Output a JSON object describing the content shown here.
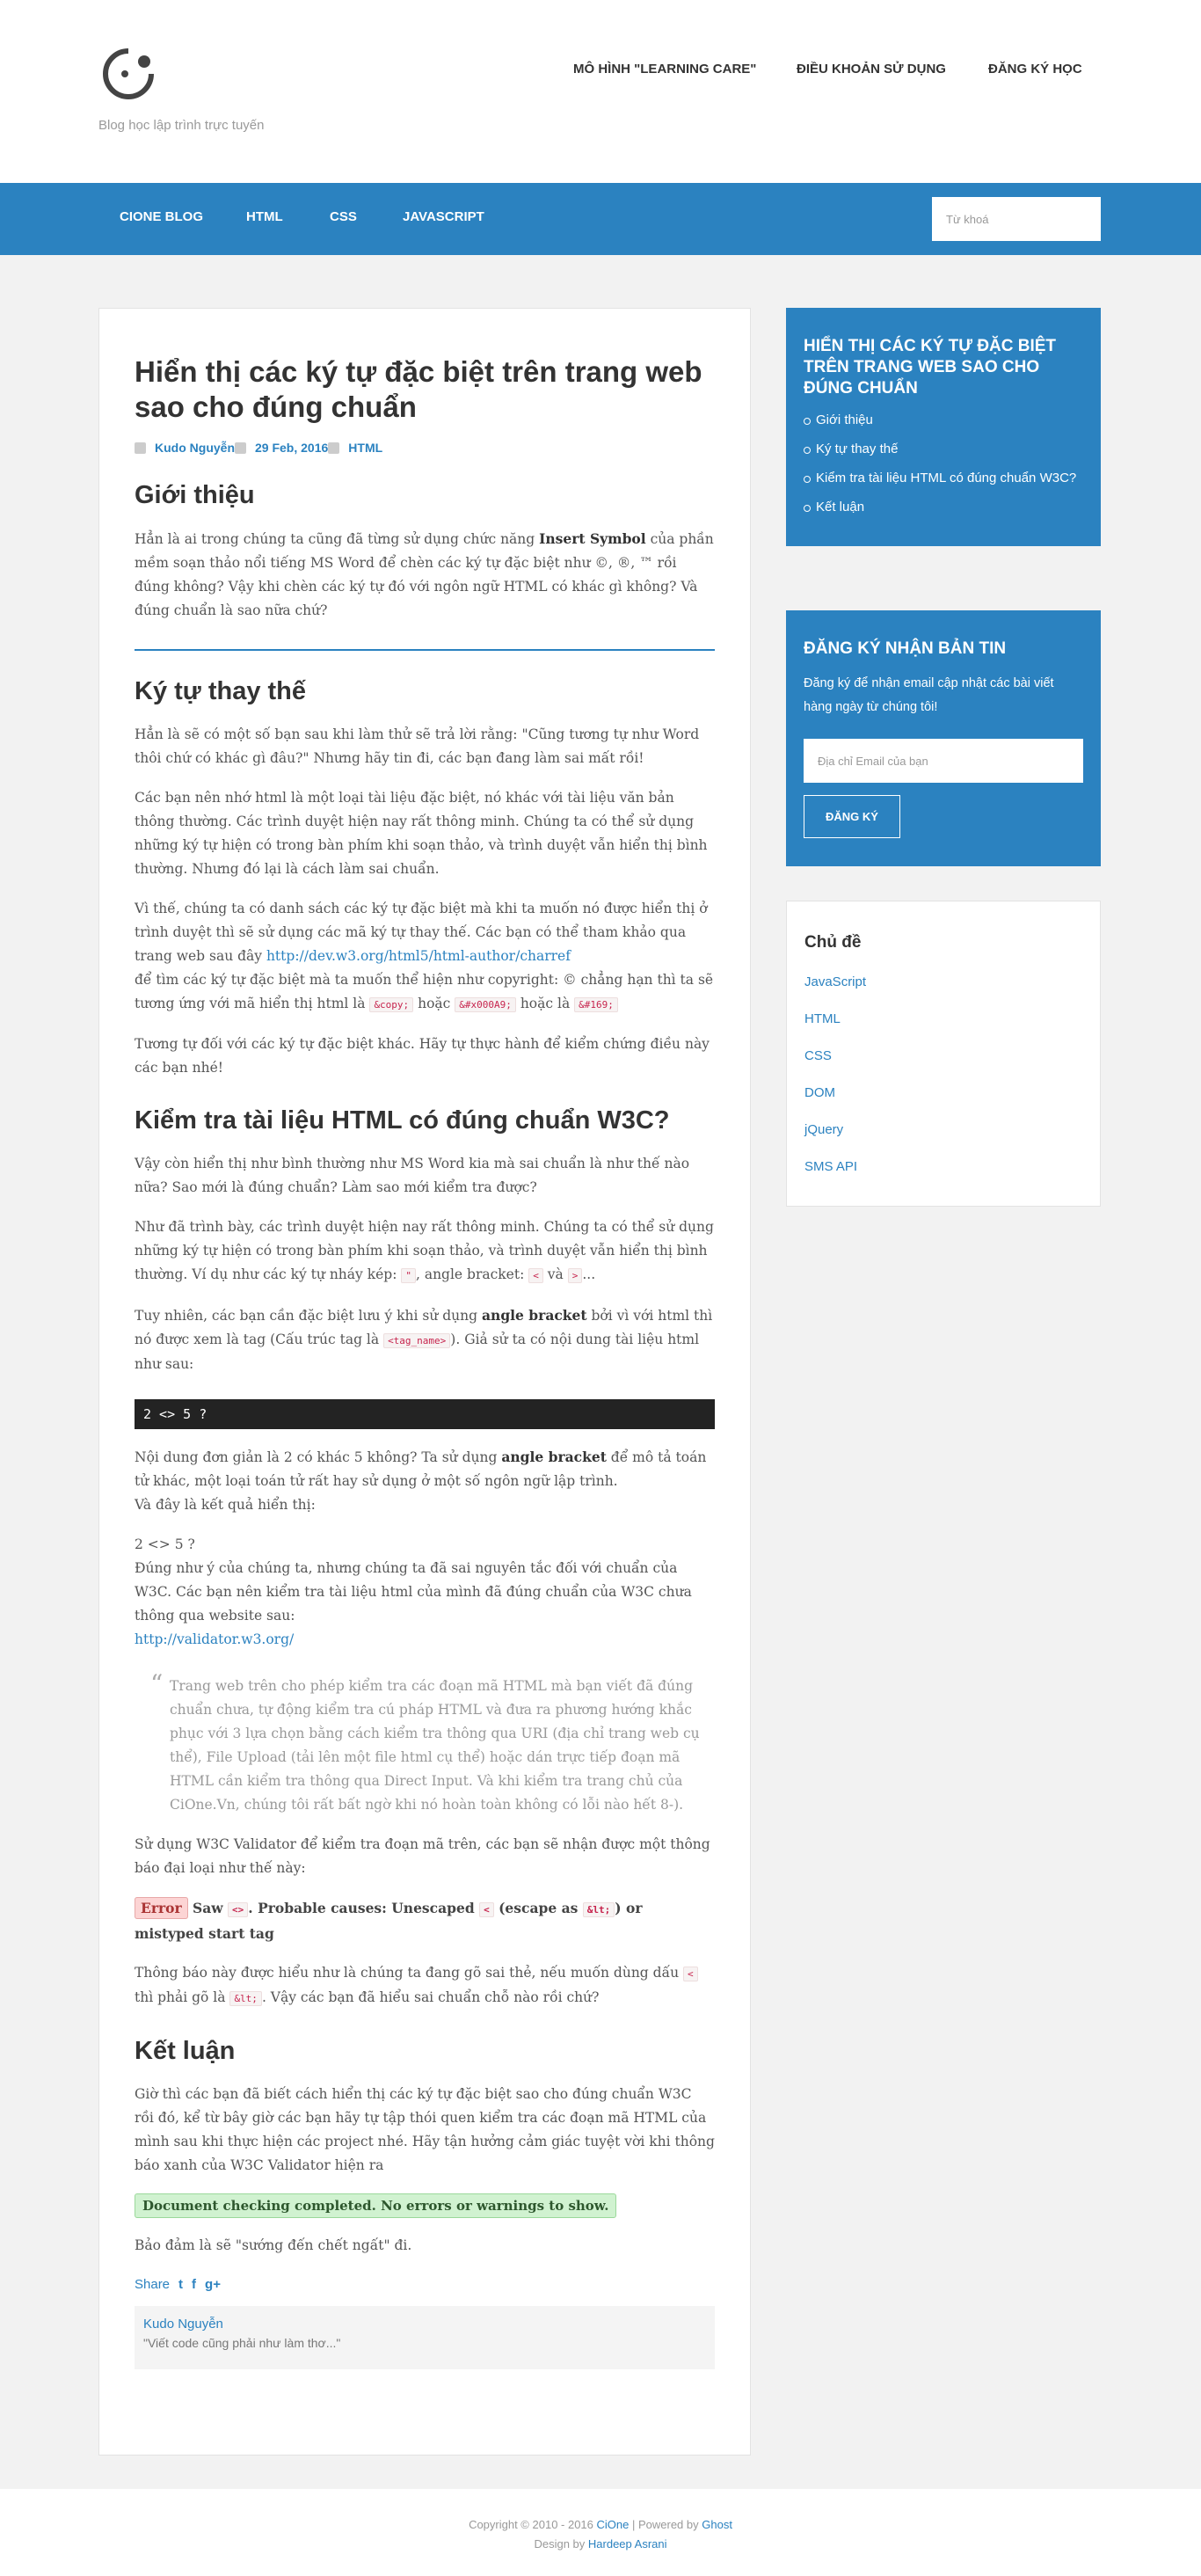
{
  "site": {
    "tagline": "Blog học lập trình trực tuyến",
    "top_nav": [
      "MÔ HÌNH \"LEARNING CARE\"",
      "ĐIỀU KHOẢN SỬ DỤNG",
      "ĐĂNG KÝ HỌC"
    ],
    "menu": [
      "CIONE BLOG",
      "HTML",
      "CSS",
      "JAVASCRIPT"
    ],
    "search_placeholder": "Từ khoá"
  },
  "post": {
    "title": "Hiển thị các ký tự đặc biệt trên trang web sao cho đúng chuẩn",
    "author": "Kudo Nguyễn",
    "date": "29 Feb, 2016",
    "tag": "HTML",
    "h_intro": "Giới thiệu",
    "p1a": "Hẳn là ai trong chúng ta cũng đã từng sử dụng chức năng ",
    "p1b": "Insert Symbol",
    "p1c": " của phần mềm soạn thảo nổi tiếng MS Word để chèn các ký tự đặc biệt như ©, ®, ™ rồi đúng không? Vậy khi chèn các ký tự đó với ngôn ngữ HTML có khác gì không? Và đúng chuẩn là sao nữa chứ?",
    "h_sub": "Ký tự thay thế",
    "p2": "Hẳn là sẽ có một số bạn sau khi làm thử sẽ trả lời rằng: \"Cũng tương tự như Word thôi chứ có khác gì đâu?\" Nhưng hãy tin đi, các bạn đang làm sai mất rồi!",
    "p3": "Các bạn nên nhớ html là một loại tài liệu đặc biệt, nó khác với tài liệu văn bản thông thường. Các trình duyệt hiện nay rất thông minh. Chúng ta có thể sử dụng những ký tự hiện có trong bàn phím khi soạn thảo, và trình duyệt vẫn hiển thị bình thường. Nhưng đó lại là cách làm sai chuẩn.",
    "p4a": "Vì thế, chúng ta có danh sách các ký tự đặc biệt mà khi ta muốn nó được hiển thị ở trình duyệt thì sẽ sử dụng các mã ký tự thay thế. Các bạn có thể tham khảo qua trang web sau đây ",
    "p4link": "http://dev.w3.org/html5/html-author/charref",
    "p4b": "để tìm các ký tự đặc biệt mà ta muốn thể hiện như copyright: © chẳng hạn thì ta sẽ tương ứng với mã hiển thị html là ",
    "c1": "&copy;",
    "p4c": " hoặc ",
    "c2": "&#x000A9;",
    "p4d": " hoặc là ",
    "c3": "&#169;",
    "p5": "Tương tự đối với các ký tự đặc biệt khác. Hãy tự thực hành để kiểm chứng điều này các bạn nhé!",
    "h_check": "Kiểm tra tài liệu HTML có đúng chuẩn W3C?",
    "p6": "Vậy còn hiển thị như bình thường như MS Word kia mà sai chuẩn là như thế nào nữa? Sao mới là đúng chuẩn? Làm sao mới kiểm tra được?",
    "p7a": "Như đã trình bày, các trình duyệt hiện nay rất thông minh. Chúng ta có thể sử dụng những ký tự hiện có trong bàn phím khi soạn thảo, và trình duyệt vẫn hiển thị bình thường. Ví dụ như các ký tự nháy kép: ",
    "c4": "\"",
    "p7b": ", angle bracket: ",
    "c5": "<",
    "p7c": " và ",
    "c6": ">",
    "p7d": "...",
    "p8a": "Tuy nhiên, các bạn cần đặc biệt lưu ý khi sử dụng ",
    "p8b": "angle bracket",
    "p8c": " bởi vì với html thì nó được xem là tag (Cấu trúc tag là ",
    "c7": "<tag_name>",
    "p8d": "). Giả sử ta có nội dung tài liệu html như sau:",
    "code": "2 <> 5 ?",
    "p9a": "Nội dung đơn giản là 2 có khác 5 không? Ta sử dụng ",
    "p9b": "angle bracket",
    "p9c": " để mô tả toán tử khác, một loại toán tử rất hay sử dụng ở một số ngôn ngữ lập trình.",
    "p9d": "Và đây là kết quả hiển thị:",
    "p10a": "2 <> 5 ?",
    "p10b": "Đúng như ý của chúng ta, nhưng chúng ta đã sai nguyên tắc đối với chuẩn của W3C. Các bạn nên kiểm tra tài liệu html của mình đã đúng chuẩn của W3C chưa thông qua website sau:",
    "p10link": "http://validator.w3.org/",
    "quote": "Trang web trên cho phép kiểm tra các đoạn mã HTML mà bạn viết đã đúng chuẩn chưa, tự động kiểm tra cú pháp HTML và đưa ra phương hướng khắc phục với 3 lựa chọn bằng cách kiểm tra thông qua URI (địa chỉ trang web cụ thể), File Upload (tải lên một file html cụ thể) hoặc dán trực tiếp đoạn mã HTML cần kiểm tra thông qua Direct Input. Và khi kiểm tra trang chủ của CiOne.Vn, chúng tôi rất bất ngờ khi nó hoàn toàn không có lỗi nào hết 8-).",
    "p11": "Sử dụng W3C Validator để kiểm tra đoạn mã trên, các bạn sẽ nhận được một thông báo đại loại như thế này:",
    "err": "Error",
    "e1": " Saw ",
    "ec1": "<>",
    "e2": ". Probable causes: Unescaped ",
    "ec2": "<",
    "e3": " (escape as ",
    "ec3": "&lt;",
    "e4": ") or mistyped start tag",
    "p12a": "Thông báo này được hiểu như là chúng ta đang gõ sai thẻ, nếu muốn dùng dấu ",
    "c8": "<",
    "p12b": " thì phải gõ là ",
    "c9": "&lt;",
    "p12c": ". Vậy các bạn đã hiểu sai chuẩn chỗ nào rồi chứ?",
    "h_end": "Kết luận",
    "p13": "Giờ thì các bạn đã biết cách hiển thị các ký tự đặc biệt sao cho đúng chuẩn W3C rồi đó, kể từ bây giờ các bạn hãy tự tập thói quen kiểm tra các đoạn mã HTML của mình sau khi thực hiện các project nhé. Hãy tận hưởng cảm giác tuyệt vời khi thông báo xanh của W3C Validator hiện ra",
    "ok": "Document checking completed. No errors or warnings to show.",
    "p14": "Bảo đảm là sẽ \"sướng đến chết ngất\" đi.",
    "share": "Share",
    "bio_name": "Kudo Nguyễn",
    "bio_quote": "\"Viết code cũng phải như làm thơ...\""
  },
  "toc": {
    "title": "Hiển thị các ký tự đặc biệt trên trang web sao cho đúng chuẩn",
    "items": [
      "Giới thiệu",
      "Ký tự thay thế",
      "Kiểm tra tài liệu HTML có đúng chuẩn W3C?",
      "Kết luận"
    ]
  },
  "newsletter": {
    "title": "Đăng ký nhận bản tin",
    "desc": "Đăng ký để nhận email cập nhật các bài viết hàng ngày từ chúng tôi!",
    "placeholder": "Địa chỉ Email của bạn",
    "button": "ĐĂNG KÝ"
  },
  "topics": {
    "title": "Chủ đề",
    "items": [
      "JavaScript",
      "HTML",
      "CSS",
      "DOM",
      "jQuery",
      "SMS API"
    ]
  },
  "footer": {
    "copy": "Copyright © 2010 - 2016 ",
    "cione": "CiOne",
    "powered": " | Powered by ",
    "ghost": "Ghost",
    "design": "Design by ",
    "designer": "Hardeep Asrani"
  }
}
